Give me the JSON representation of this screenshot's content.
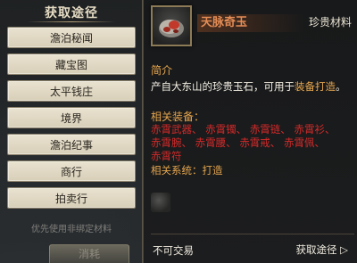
{
  "left": {
    "title": "获取途径",
    "buttons": [
      "澹泊秘闻",
      "藏宝图",
      "太平钱庄",
      "境界",
      "澹泊纪事",
      "商行",
      "拍卖行"
    ],
    "hint": "优先使用非绑定材料",
    "use_button": "消耗"
  },
  "item": {
    "name": "天脉奇玉",
    "rarity": "珍贵材料",
    "intro_heading": "简介",
    "description_prefix": "产自大东山的珍贵玉石，可用于",
    "description_link": "装备打造",
    "description_suffix": "。",
    "related_equipment_heading": "相关装备：",
    "related_equipment": [
      "赤霄武器、",
      "赤霄镯、",
      "赤霄链、",
      "赤霄衫、",
      "赤霄腕、",
      "赤霄腰、",
      "赤霄戒、",
      "赤霄佩、",
      "赤霄符"
    ],
    "related_system_label": "相关系统：",
    "related_system": "打造",
    "untradeable": "不可交易",
    "source_link": "获取途径 ▷"
  },
  "colors": {
    "accent": "#e6a64e",
    "equipment": "#d42a2a",
    "name": "#e38c55"
  }
}
